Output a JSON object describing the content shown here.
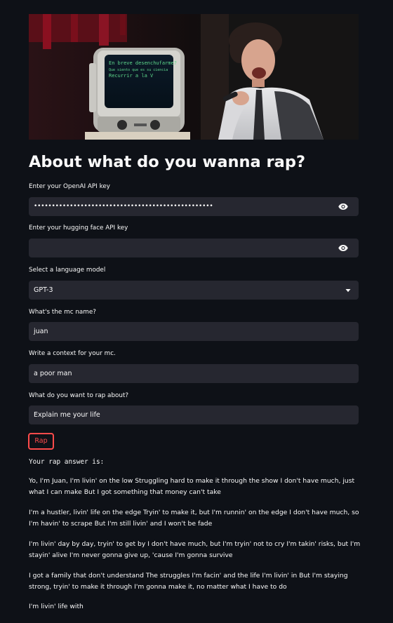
{
  "header": {
    "image_alt": "banner-image",
    "monitor_text": [
      "En breve desenchufarme?",
      "Que siento que es su ciencia",
      "Recurrir a la V"
    ]
  },
  "title": "About what do you wanna rap?",
  "fields": {
    "openai_key": {
      "label": "Enter your OpenAI API key",
      "value": "••••••••••••••••••••••••••••••••••••••••••••••••••"
    },
    "hf_key": {
      "label": "Enter your hugging face API key",
      "value": ""
    },
    "model": {
      "label": "Select a language model",
      "value": "GPT-3"
    },
    "mc_name": {
      "label": "What's the mc name?",
      "value": "juan"
    },
    "context": {
      "label": "Write a context for your mc.",
      "value": "a poor man"
    },
    "topic": {
      "label": "What do you want to rap about?",
      "value": "Explain me your life"
    }
  },
  "actions": {
    "rap_label": "Rap"
  },
  "answer": {
    "heading": "Your rap answer is:",
    "paragraphs": [
      "Yo, I'm Juan, I'm livin' on the low Struggling hard to make it through the show I don't have much, just what I can make But I got something that money can't take",
      "I'm a hustler, livin' life on the edge Tryin' to make it, but I'm runnin' on the edge I don't have much, so I'm havin' to scrape But I'm still livin' and I won't be fade",
      "I'm livin' day by day, tryin' to get by I don't have much, but I'm tryin' not to cry I'm takin' risks, but I'm stayin' alive I'm never gonna give up, 'cause I'm gonna survive",
      "I got a family that don't understand The struggles I'm facin' and the life I'm livin' in But I'm staying strong, tryin' to make it through I'm gonna make it, no matter what I have to do",
      "I'm livin' life with"
    ]
  },
  "icons": {
    "password_toggle": "eye-icon",
    "select_toggle": "chevron-down-icon"
  },
  "colors": {
    "background": "#0e1117",
    "input_bg": "#262730",
    "accent": "#ff4b4b",
    "text": "#fafafa"
  }
}
